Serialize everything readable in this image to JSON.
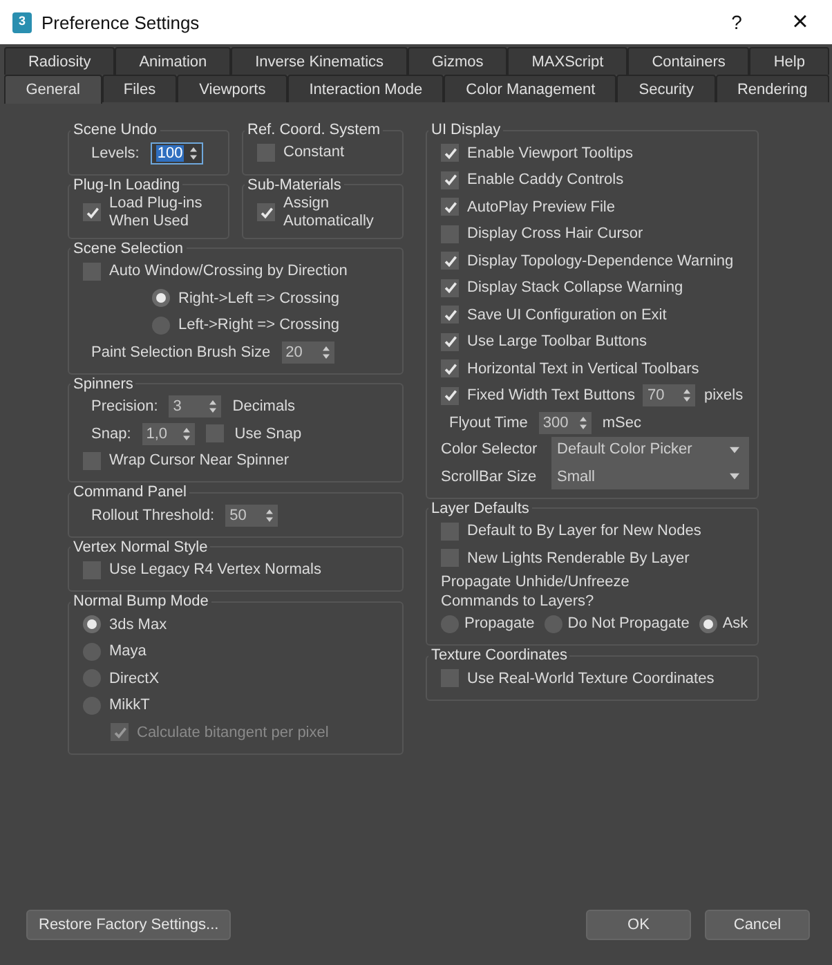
{
  "window": {
    "app_icon_text": "3",
    "title": "Preference Settings",
    "help": "?",
    "close": "×"
  },
  "tab_rows": [
    [
      {
        "label": "Radiosity",
        "selected": false
      },
      {
        "label": "Animation",
        "selected": false
      },
      {
        "label": "Inverse Kinematics",
        "selected": false
      },
      {
        "label": "Gizmos",
        "selected": false
      },
      {
        "label": "MAXScript",
        "selected": false
      },
      {
        "label": "Containers",
        "selected": false
      },
      {
        "label": "Help",
        "selected": false
      }
    ],
    [
      {
        "label": "General",
        "selected": true
      },
      {
        "label": "Files",
        "selected": false
      },
      {
        "label": "Viewports",
        "selected": false
      },
      {
        "label": "Interaction Mode",
        "selected": false
      },
      {
        "label": "Color Management",
        "selected": false
      },
      {
        "label": "Security",
        "selected": false
      },
      {
        "label": "Rendering",
        "selected": false
      }
    ]
  ],
  "left_column": [
    [
      {
        "title": "Scene Undo",
        "items": [
          {
            "kind": "spinner",
            "label": "Levels:",
            "value": "100",
            "highlighted": true
          }
        ]
      },
      {
        "title": "Ref. Coord. System",
        "items": [
          {
            "kind": "checkbox",
            "label": "Constant",
            "checked": false
          }
        ]
      }
    ],
    [
      {
        "title": "Plug-In Loading",
        "items": [
          {
            "kind": "checkbox",
            "label": "Load Plug-ins When Used",
            "checked": true
          }
        ]
      },
      {
        "title": "Sub-Materials",
        "items": [
          {
            "kind": "checkbox",
            "label": "Assign Automatically",
            "checked": true
          }
        ]
      }
    ],
    [
      {
        "title": "Scene Selection",
        "items": [
          {
            "kind": "checkbox",
            "label": "Auto Window/Crossing by Direction",
            "checked": false,
            "children": [
              {
                "label": "Right->Left => Crossing",
                "selected": true
              },
              {
                "label": "Left->Right => Crossing",
                "selected": false
              }
            ]
          },
          {
            "kind": "spinner",
            "label": "Paint Selection Brush Size",
            "value": "20",
            "highlighted": false
          }
        ]
      }
    ],
    [
      {
        "title": "Spinners",
        "items": [
          {
            "kind": "spinner",
            "label": "Precision:",
            "value": "3",
            "highlighted": false,
            "suffix": "Decimals"
          },
          {
            "kind": "spinner",
            "label": "Snap:",
            "value": "1,0",
            "highlighted": false,
            "check": {
              "label": "Use Snap",
              "checked": false
            }
          },
          {
            "kind": "checkbox",
            "label": "Wrap Cursor Near Spinner",
            "checked": false
          }
        ]
      }
    ],
    [
      {
        "title": "Command Panel",
        "items": [
          {
            "kind": "spinner",
            "label": "Rollout Threshold:",
            "value": "50",
            "highlighted": false
          }
        ]
      }
    ],
    [
      {
        "title": "Vertex Normal Style",
        "items": [
          {
            "kind": "checkbox",
            "label": "Use Legacy R4 Vertex Normals",
            "checked": false
          }
        ]
      }
    ],
    [
      {
        "title": "Normal Bump Mode",
        "items": [
          {
            "kind": "radio",
            "label": "3ds Max",
            "selected": true
          },
          {
            "kind": "radio",
            "label": "Maya",
            "selected": false
          },
          {
            "kind": "radio",
            "label": "DirectX",
            "selected": false
          },
          {
            "kind": "radio",
            "label": "MikkT",
            "selected": false
          },
          {
            "kind": "checkbox",
            "label": "Calculate bitangent per pixel",
            "checked": true,
            "disabled": true
          }
        ]
      }
    ]
  ],
  "right_column": [
    [
      {
        "title": "UI Display",
        "items": [
          {
            "kind": "checkbox",
            "label": "Enable Viewport Tooltips",
            "checked": true
          },
          {
            "kind": "checkbox",
            "label": "Enable Caddy Controls",
            "checked": true
          },
          {
            "kind": "checkbox",
            "label": "AutoPlay Preview File",
            "checked": true
          },
          {
            "kind": "checkbox",
            "label": "Display Cross Hair Cursor",
            "checked": false
          },
          {
            "kind": "checkbox",
            "label": "Display Topology-Dependence Warning",
            "checked": true
          },
          {
            "kind": "checkbox",
            "label": "Display Stack Collapse Warning",
            "checked": true
          },
          {
            "kind": "checkbox",
            "label": "Save UI Configuration on Exit",
            "checked": true
          },
          {
            "kind": "checkbox",
            "label": "Use Large Toolbar Buttons",
            "checked": true
          },
          {
            "kind": "checkbox",
            "label": "Horizontal Text in Vertical Toolbars",
            "checked": true
          },
          {
            "kind": "checkbox",
            "label": "Fixed Width Text Buttons",
            "checked": true,
            "value": "70",
            "suffix": "pixels"
          },
          {
            "kind": "spinner",
            "label": "Flyout Time",
            "value": "300",
            "highlighted": false,
            "suffix": "mSec"
          },
          {
            "kind": "dropdown",
            "label": "Color Selector",
            "value": "Default Color Picker"
          },
          {
            "kind": "dropdown",
            "label": "ScrollBar Size",
            "value": "Small"
          }
        ]
      }
    ],
    [
      {
        "title": "Layer Defaults",
        "items": [
          {
            "kind": "checkbox",
            "label": "Default to By Layer for New Nodes",
            "checked": false
          },
          {
            "kind": "checkbox",
            "label": "New Lights Renderable By Layer",
            "checked": false
          },
          {
            "kind": "text",
            "text": "Propagate Unhide/Unfreeze Commands to Layers?"
          },
          {
            "kind": "radio-row",
            "options": [
              {
                "label": "Propagate",
                "selected": false
              },
              {
                "label": "Do Not Propagate",
                "selected": false
              },
              {
                "label": "Ask",
                "selected": true
              }
            ]
          }
        ]
      }
    ],
    [
      {
        "title": "Texture Coordinates",
        "items": [
          {
            "kind": "checkbox",
            "label": "Use Real-World Texture Coordinates",
            "checked": false
          }
        ]
      }
    ]
  ],
  "footer": {
    "restore": "Restore Factory Settings...",
    "buttons": [
      "OK",
      "Cancel"
    ]
  }
}
